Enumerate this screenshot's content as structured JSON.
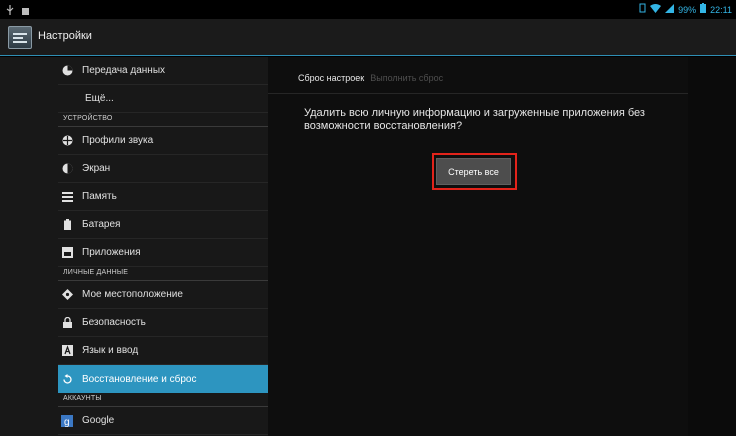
{
  "status_bar": {
    "battery": "99%",
    "time": "22:11"
  },
  "header": {
    "title": "Настройки"
  },
  "sidebar": {
    "items": [
      {
        "label": "Передача данных",
        "icon": "data-usage-icon"
      },
      {
        "label": "Ещё..."
      },
      {
        "label": "Профили звука",
        "icon": "sound-icon"
      },
      {
        "label": "Экран",
        "icon": "display-icon"
      },
      {
        "label": "Память",
        "icon": "storage-icon"
      },
      {
        "label": "Батарея",
        "icon": "battery-icon"
      },
      {
        "label": "Приложения",
        "icon": "apps-icon"
      },
      {
        "label": "Мое местоположение",
        "icon": "location-icon"
      },
      {
        "label": "Безопасность",
        "icon": "lock-icon"
      },
      {
        "label": "Язык и ввод",
        "icon": "keyboard-icon"
      },
      {
        "label": "Восстановление и сброс",
        "icon": "backup-icon",
        "active": true
      },
      {
        "label": "Google",
        "icon": "google-icon"
      }
    ],
    "sections": {
      "device": "УСТРОЙСТВО",
      "personal": "ЛИЧНЫЕ ДАННЫЕ",
      "accounts": "АККАУНТЫ"
    }
  },
  "main": {
    "breadcrumb": {
      "current": "Сброс настроек",
      "next": "Выполнить сброс"
    },
    "message": "Удалить всю личную информацию и загруженные приложения без возможности восстановления?",
    "erase_button": "Стереть все"
  },
  "colors": {
    "accent": "#2d95c0",
    "highlight_box": "#e2231a"
  }
}
